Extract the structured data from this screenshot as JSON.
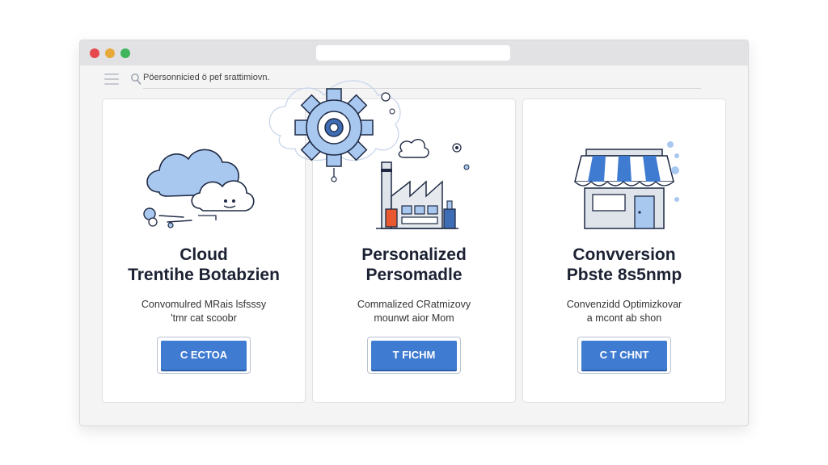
{
  "browser": {
    "search_text": "Pöersonnicied ö pef srattimiovn."
  },
  "cards": [
    {
      "title_line1": "Cloud",
      "title_line2": "Trentihe Botabzien",
      "desc_line1": "Convomulred MRais lsfsssy",
      "desc_line2": "'tmr cat scoobr",
      "button_label": "C ECTOA",
      "icon": "cloud-icon"
    },
    {
      "title_line1": "Personalized",
      "title_line2": "Persomadle",
      "desc_line1": "Commalized CRatmizovy",
      "desc_line2": "mounwt aior Mom",
      "button_label": "T FICHM",
      "icon": "factory-icon"
    },
    {
      "title_line1": "Convversion",
      "title_line2": "Pbste 8s5nmp",
      "desc_line1": "Convenzidd Optimizkovar",
      "desc_line2": "a mcont ab shon",
      "button_label": "C T CHNT",
      "icon": "storefront-icon"
    }
  ],
  "colors": {
    "accent": "#3f7bd1",
    "illustration_blue": "#a9c8f0",
    "outline": "#1e2a44"
  }
}
